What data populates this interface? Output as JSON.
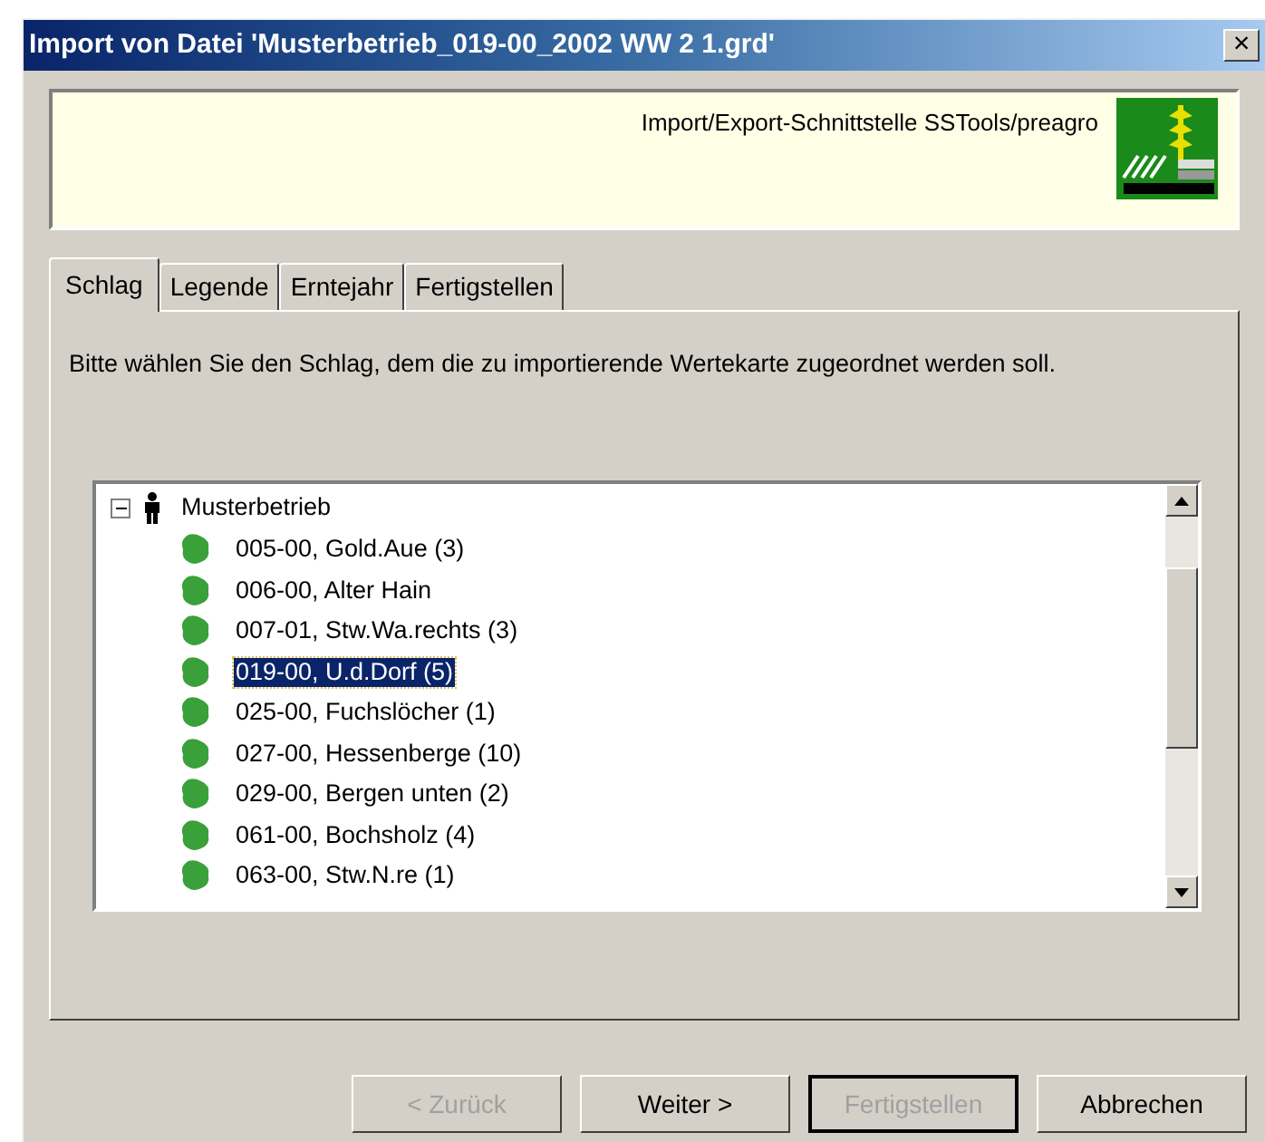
{
  "window": {
    "title": "Import von Datei 'Musterbetrieb_019-00_2002 WW  2 1.grd'",
    "close": "×"
  },
  "banner": {
    "text": "Import/Export-Schnittstelle SSTools/preagro"
  },
  "tabs": [
    {
      "label": "Schlag",
      "selected": true
    },
    {
      "label": "Legende",
      "selected": false
    },
    {
      "label": "Erntejahr",
      "selected": false
    },
    {
      "label": "Fertigstellen",
      "selected": false
    }
  ],
  "instruction": "Bitte wählen Sie den Schlag, dem die zu importierende Wertekarte zugeordnet werden soll.",
  "tree": {
    "label": "Musterbetrieb",
    "expanded": true,
    "children": [
      {
        "label": "005-00, Gold.Aue (3)",
        "selected": false
      },
      {
        "label": "006-00, Alter Hain",
        "selected": false
      },
      {
        "label": "007-01, Stw.Wa.rechts (3)",
        "selected": false
      },
      {
        "label": "019-00, U.d.Dorf (5)",
        "selected": true
      },
      {
        "label": "025-00, Fuchslöcher (1)",
        "selected": false
      },
      {
        "label": "027-00, Hessenberge (10)",
        "selected": false
      },
      {
        "label": "029-00, Bergen unten (2)",
        "selected": false
      },
      {
        "label": "061-00, Bochsholz (4)",
        "selected": false
      },
      {
        "label": "063-00, Stw.N.re (1)",
        "selected": false
      }
    ]
  },
  "buttons": [
    {
      "label": "< Zurück",
      "disabled": true,
      "default": false
    },
    {
      "label": "Weiter >",
      "disabled": false,
      "default": false
    },
    {
      "label": "Fertigstellen",
      "disabled": true,
      "default": true
    },
    {
      "label": "Abbrechen",
      "disabled": false,
      "default": false
    }
  ]
}
